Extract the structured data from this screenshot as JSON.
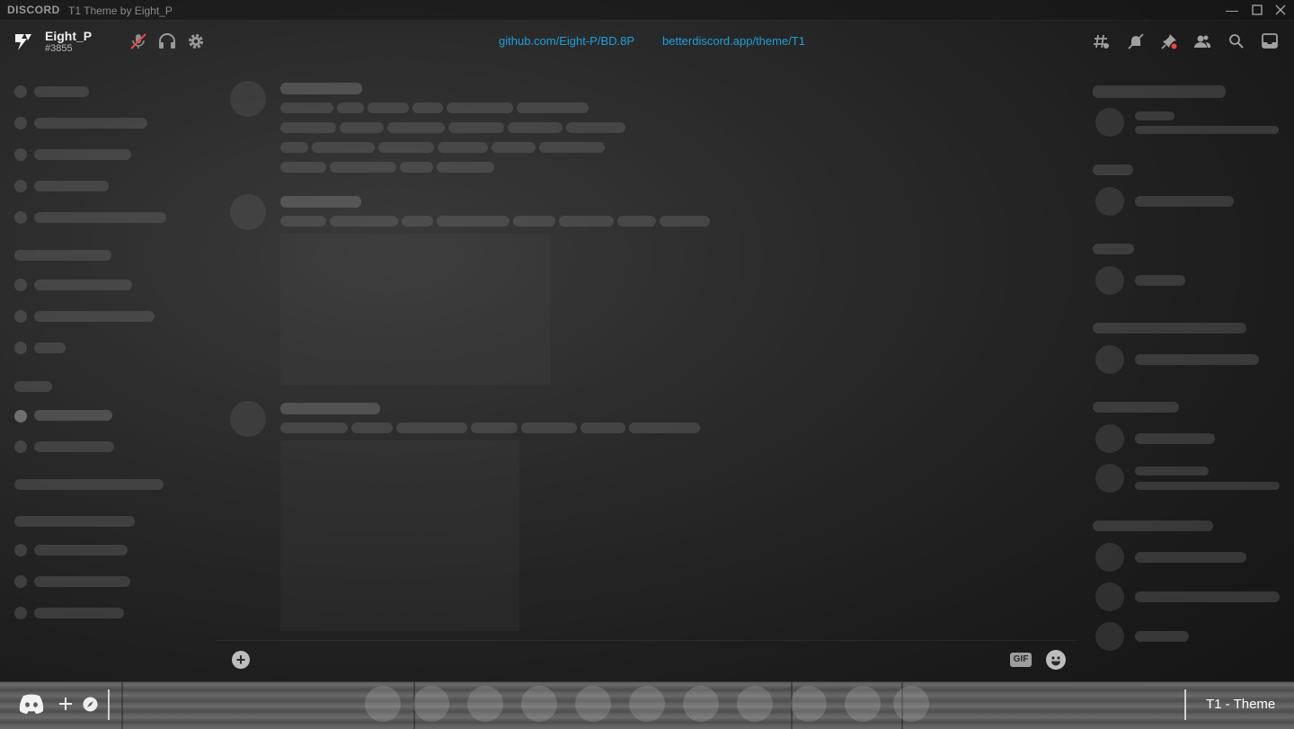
{
  "titlebar": {
    "brand": "DISCORD",
    "title": "T1 Theme by Eight_P",
    "controls": [
      "minimize",
      "maximize",
      "close"
    ]
  },
  "user": {
    "name": "Eight_P",
    "tag": "#3855"
  },
  "header": {
    "links": [
      "github.com/Eight-P/BD.8P",
      "betterdiscord.app/theme/T1"
    ]
  },
  "chat": {
    "gif_label": "GIF"
  },
  "bottombar": {
    "title": "T1 - Theme"
  },
  "colors": {
    "link": "#1ea0d8",
    "notification": "#ed4245"
  }
}
